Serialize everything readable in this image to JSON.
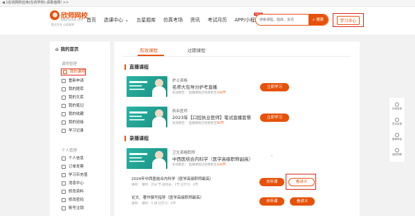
{
  "topbar": {
    "text": "◀ 1在线网校应用(在线学校)-请取值网! >>"
  },
  "logo": {
    "name": "欣师网校",
    "url": "www.xxxxx.com",
    "slogan": "智达专业 以信筑梦"
  },
  "nav": {
    "items": [
      "首页",
      "选课中心 ⌄",
      "五星题库",
      "仿真考场",
      "资讯",
      "考试月历",
      "APP/小程序"
    ],
    "hot": "HOT"
  },
  "search": {
    "placeholder": "搜索课程、题库、资讯",
    "button": "搜索",
    "icon": "search-icon"
  },
  "header": {
    "study_center": "学习中心"
  },
  "sidebar": {
    "home": "我的首页",
    "group1": "课程管理",
    "items1": [
      "我的课程",
      "重新申请",
      "我的题库",
      "我的文库",
      "我的笔记",
      "我的收藏",
      "我的班级",
      "学习记录"
    ],
    "group2": "个人管理",
    "items2": [
      "个人信息",
      "订单发票",
      "学习币充值",
      "消息中心",
      "修改资料",
      "修改密码",
      "账号注销"
    ]
  },
  "tabs": [
    "有效课程",
    "过期课程"
  ],
  "live": {
    "title": "直播课程",
    "courses": [
      {
        "category": "护士资格",
        "name": "名师大包导分护考直播",
        "meta": "有效期至：  直播课程已经更新至",
        "count": "144节",
        "button": "立即学习"
      },
      {
        "category": "执业医师",
        "name": "2023年【口腔执业医师】笔试直播套餐",
        "meta": "有效期至：  直播课程已经更新至",
        "count": "92节",
        "button": "立即学习"
      }
    ]
  },
  "recorded": {
    "title": "录播课程",
    "course": {
      "category": "卫生资格职称",
      "name": "中西医结合内科学（医学高级职称副高）",
      "meta": "有效期至：  直播课程已经更新至",
      "count": "144节"
    },
    "subs": [
      {
        "name": "2024年中西医结合内科学（医学高级职称副高）",
        "meta": "讲师： 课时：258 节 总时长：1节 已学习：0节",
        "listen": "去听课",
        "handout": "看讲义"
      },
      {
        "name": "论文、著作撰写指导（医学高级职称副高）",
        "meta": "讲师：  课时：5 讲 已学习：0节",
        "listen": "去听课",
        "handout": "看讲义"
      }
    ]
  },
  "rightbar": [
    "在线咨询",
    "意见反馈",
    "客服电话",
    "返回顶部"
  ],
  "icons": {
    "up": "⌃"
  }
}
